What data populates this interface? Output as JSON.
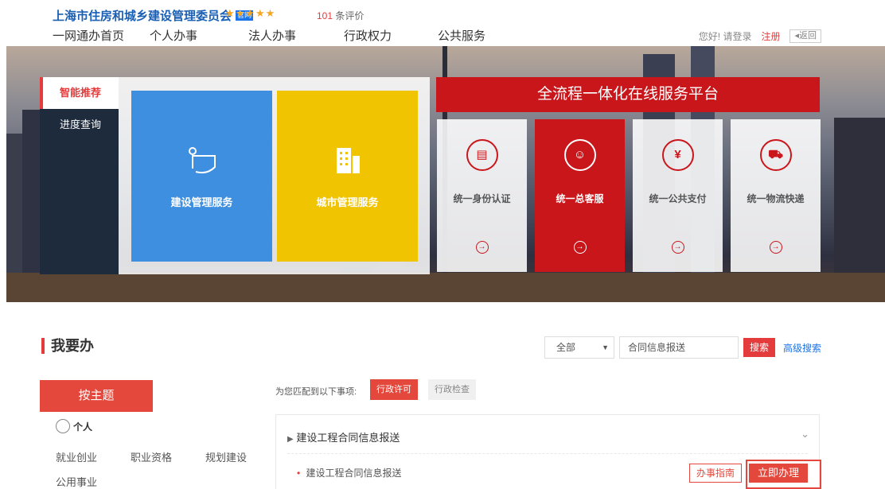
{
  "header": {
    "org_title": "上海市住房和城乡建设管理委员会",
    "official_badge": "官网",
    "stars": "★★★★★",
    "review_count": "101",
    "review_suffix": "条评价"
  },
  "nav": [
    "一网通办首页",
    "个人办事",
    "法人办事",
    "行政权力",
    "公共服务"
  ],
  "user": {
    "greeting": "您好! 请登录",
    "register": "注册",
    "back": "◂返回"
  },
  "banner": {
    "tabs": [
      "智能推荐",
      "进度查询"
    ],
    "cards": [
      {
        "label": "建设管理服务",
        "color": "#3f8fe0",
        "icon": "construction-crane-icon"
      },
      {
        "label": "城市管理服务",
        "color": "#f0c400",
        "icon": "building-icon"
      }
    ],
    "platform_title": "全流程一体化在线服务平台",
    "services": [
      {
        "label": "统一身份认证",
        "icon": "id-card-icon",
        "glyph": "▤"
      },
      {
        "label": "统一总客服",
        "icon": "headset-icon",
        "glyph": "☺"
      },
      {
        "label": "统一公共支付",
        "icon": "yuan-icon",
        "glyph": "¥"
      },
      {
        "label": "统一物流快递",
        "icon": "truck-icon",
        "glyph": "⛟"
      }
    ],
    "go_glyph": "→"
  },
  "section": {
    "title": "我要办",
    "scope_select": "全部",
    "search_value": "合同信息报送",
    "search_button": "搜索",
    "advanced_search": "高级搜索",
    "theme_button": "按主题",
    "person_label": "个人",
    "categories": [
      "就业创业",
      "职业资格",
      "规划建设",
      "公用事业"
    ],
    "match_text": "为您匹配到以下事项:",
    "permit_tabs": [
      "行政许可",
      "行政检查"
    ],
    "item_title": "建设工程合同信息报送",
    "sub_item": "建设工程合同信息报送",
    "guide_button": "办事指南",
    "do_button": "立即办理"
  }
}
